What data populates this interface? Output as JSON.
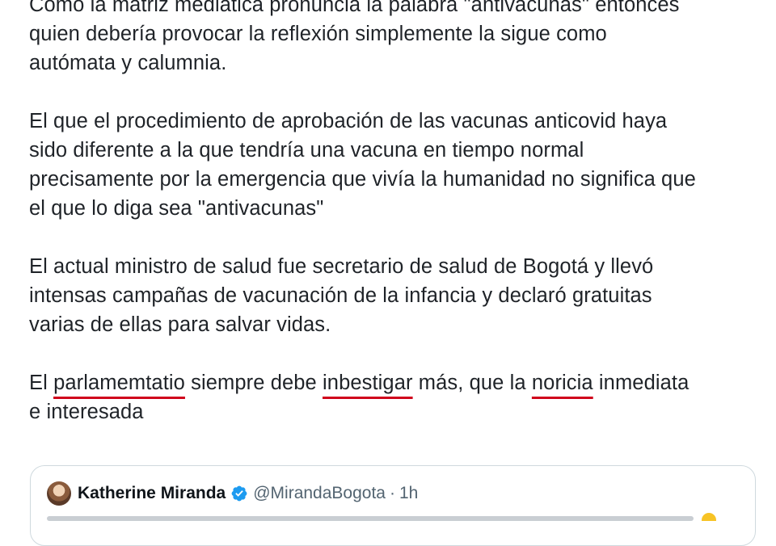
{
  "tweet": {
    "paragraphs": [
      {
        "lines": [
          "Como la matriz mediática pronuncia la palabra \"antivacunas\" entonces",
          "quien debería provocar la reflexión  simplemente la sigue como",
          "autómata y calumnia."
        ]
      },
      {
        "lines": [
          "El que el procedimiento de aprobación de las vacunas anticovid haya",
          "sido diferente a la que tendría una vacuna en tiempo normal",
          "precisamente por la emergencia que vivía la humanidad no significa que",
          "el que lo diga sea \"antivacunas\""
        ]
      },
      {
        "lines": [
          "El actual ministro de salud fue secretario de salud de Bogotá y llevó",
          "intensas campañas de vacunación de la infancia y declaró gratuitas",
          "varias de ellas para salvar vidas."
        ]
      }
    ],
    "last_paragraph": {
      "line1": {
        "w1": "El ",
        "typo1": "parlamemtatio",
        "w2": " siempre debe ",
        "typo2": "inbestigar",
        "w3": " más, que la ",
        "typo3": "noricia",
        "w4": " inmediata"
      },
      "line2": "e interesada"
    },
    "underline_color": "#d0021b"
  },
  "quoted_tweet": {
    "author_name": "Katherine Miranda",
    "handle": "@MirandaBogota",
    "separator": "·",
    "time": "1h",
    "verified_color": "#1d9bf0",
    "icons": [
      "avatar",
      "verified-badge-icon"
    ]
  }
}
